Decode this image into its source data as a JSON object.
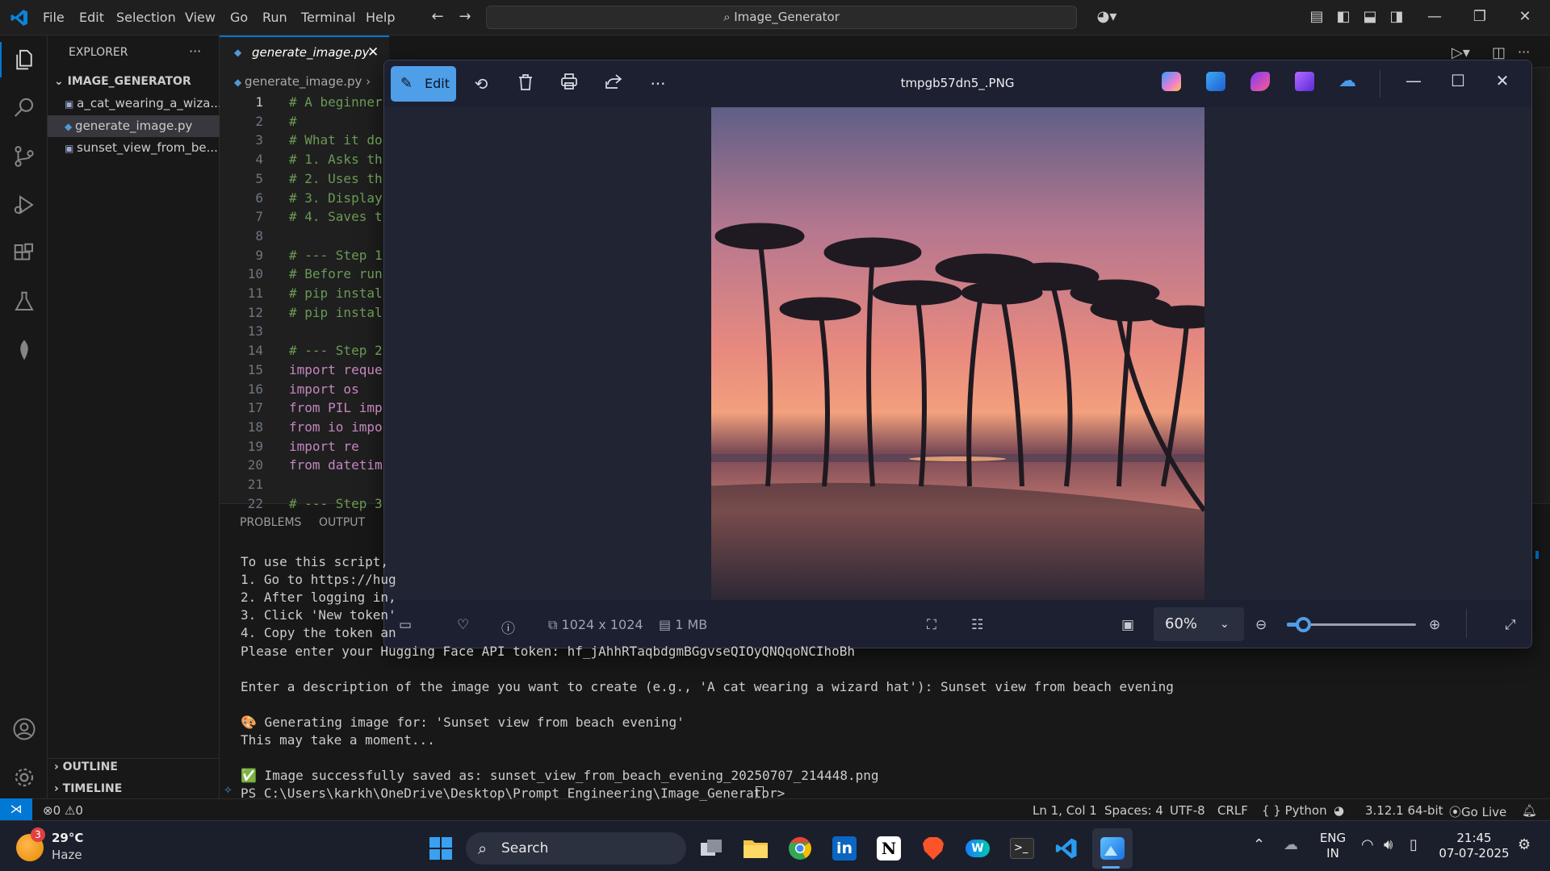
{
  "titlebar": {
    "menus": [
      "File",
      "Edit",
      "Selection",
      "View",
      "Go",
      "Run",
      "Terminal",
      "Help"
    ],
    "command_center": "Image_Generator"
  },
  "explorer": {
    "header": "EXPLORER",
    "folder": "IMAGE_GENERATOR",
    "files": [
      "a_cat_wearing_a_wiza...",
      "generate_image.py",
      "sunset_view_from_be..."
    ],
    "outline": "OUTLINE",
    "timeline": "TIMELINE"
  },
  "editor": {
    "tab_label": "generate_image.py",
    "breadcrumb": "generate_image.py",
    "line_numbers": [
      "1",
      "2",
      "3",
      "4",
      "5",
      "6",
      "7",
      "8",
      "9",
      "10",
      "11",
      "12",
      "13",
      "14",
      "15",
      "16",
      "17",
      "18",
      "19",
      "20",
      "21",
      "22"
    ],
    "lines": [
      "# A beginner",
      "#",
      "# What it do",
      "# 1. Asks th",
      "# 2. Uses th",
      "# 3. Display",
      "# 4. Saves t",
      "",
      "# --- Step 1",
      "# Before run",
      "# pip instal",
      "# pip instal",
      "",
      "# --- Step 2",
      "import reque",
      "import os",
      "from PIL imp",
      "from io impo",
      "import re",
      "from datetim",
      "",
      "# --- Step 3"
    ]
  },
  "panel": {
    "tabs": [
      "PROBLEMS",
      "OUTPUT"
    ],
    "terminal_lines": [
      "To use this script,",
      "1. Go to https://hug",
      "2. After logging in,",
      "3. Click 'New token'",
      "4. Copy the token an",
      "Please enter your Hugging Face API token: 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",
      "",
      "Enter a description of the image you want to create (e.g., 'A cat wearing a wizard hat'): Sunset view from beach evening",
      "",
      "🎨 Generating image for: 'Sunset view from beach evening'",
      "This may take a moment...",
      "",
      "✅ Image successfully saved as: sunset_view_from_beach_evening_20250707_214448.png",
      "PS C:\\Users\\karkh\\OneDrive\\Desktop\\Prompt Engineering\\Image_Generator> "
    ]
  },
  "statusbar": {
    "errors": "0",
    "warnings": "0",
    "position": "Ln 1, Col 1",
    "spaces": "Spaces: 4",
    "encoding": "UTF-8",
    "eol": "CRLF",
    "language": "Python",
    "interpreter": "3.12.1 64-bit",
    "golive": "Go Live"
  },
  "photos": {
    "edit_label": "Edit",
    "file_name": "tmpgb57dn5_.PNG",
    "dimensions": "1024 x 1024",
    "size": "1 MB",
    "zoom": "60%",
    "zoom_slider_fraction": 0.1
  },
  "taskbar": {
    "weather_temp": "29°C",
    "weather_desc": "Haze",
    "weather_badge": "3",
    "search_label": "Search",
    "lang_line1": "ENG",
    "lang_line2": "IN",
    "time": "21:45",
    "date": "07-07-2025"
  },
  "colors": {
    "accent": "#0078d4",
    "photos_accent": "#4f9ee8"
  }
}
